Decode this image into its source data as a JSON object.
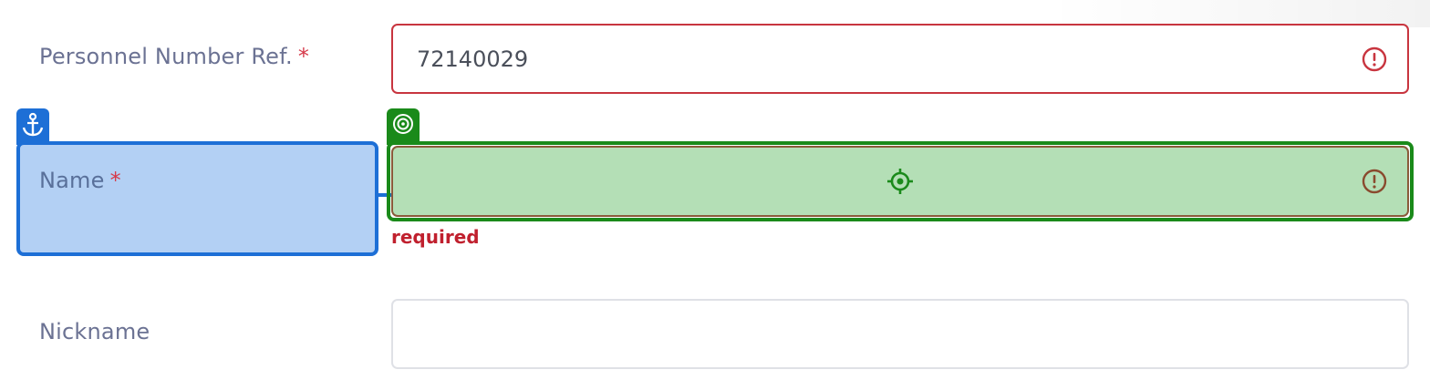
{
  "form": {
    "personnel": {
      "label": "Personnel Number Ref.",
      "required_mark": "*",
      "value": "72140029"
    },
    "name": {
      "label": "Name",
      "required_mark": "*",
      "value": "",
      "error": "required"
    },
    "nickname": {
      "label": "Nickname",
      "value": ""
    }
  },
  "overlay": {
    "anchor_icon": "anchor-icon",
    "target_icon": "target-icon",
    "crosshair_icon": "crosshair-icon"
  },
  "colors": {
    "anchor": "#1d6fd6",
    "target": "#1a8a1a",
    "error": "#c8353f"
  }
}
